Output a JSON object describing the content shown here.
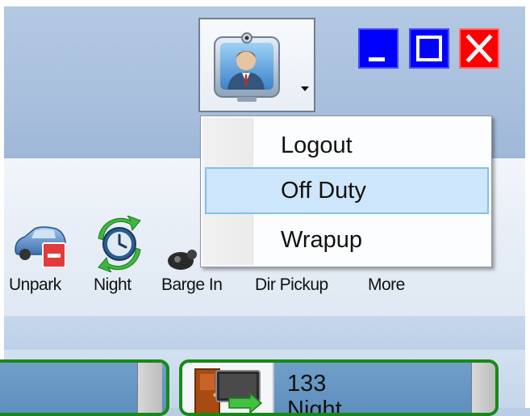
{
  "window_controls": {
    "minimize": "minimize-icon",
    "maximize": "maximize-icon",
    "close": "close-icon"
  },
  "status_button": {
    "icon": "agent-avatar-icon",
    "caret": "caret-down-icon"
  },
  "status_menu": {
    "items": [
      {
        "label": "Logout",
        "selected": false
      },
      {
        "label": "Off Duty",
        "selected": true
      },
      {
        "label": "Wrapup",
        "selected": false
      }
    ]
  },
  "toolbar": {
    "buttons": [
      {
        "label": "Unpark",
        "icon": "car-park-icon"
      },
      {
        "label": "Night",
        "icon": "night-clock-icon"
      },
      {
        "label": "Barge In",
        "icon": "barge-in-icon"
      },
      {
        "label": "Dir Pickup",
        "icon": "dir-pickup-icon"
      },
      {
        "label": "More",
        "icon": "more-icon"
      }
    ]
  },
  "extensions": [
    {
      "number": "",
      "status": "",
      "icon": ""
    },
    {
      "number": "133",
      "status": "Night",
      "icon": "door-monitor-icon"
    }
  ],
  "colors": {
    "accent_blue": "#0000ff",
    "close_red": "#ff0000",
    "selection": "#cde6fb",
    "panel_border": "#168a16"
  }
}
